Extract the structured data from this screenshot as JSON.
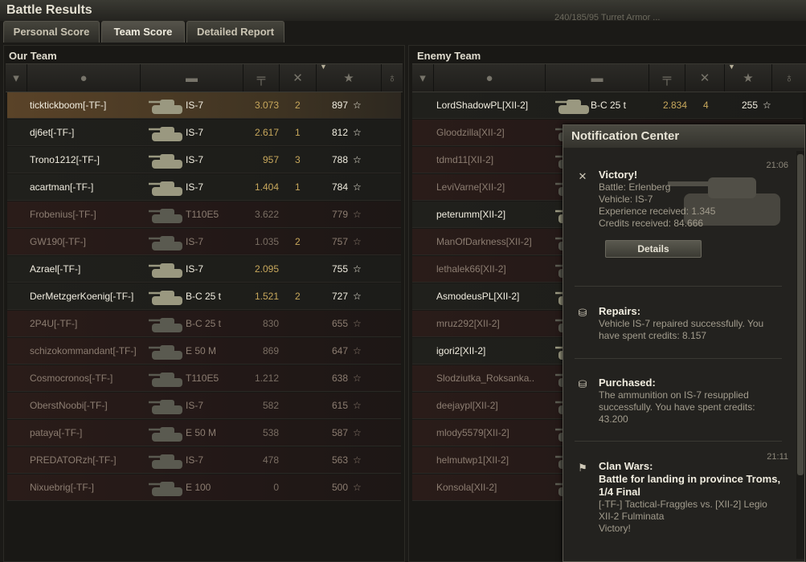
{
  "window": {
    "title": "Battle Results",
    "background_text": "240/185/95  Turret Armor  ..."
  },
  "tabs": [
    {
      "label": "Personal Score",
      "active": false
    },
    {
      "label": "Team Score",
      "active": true
    },
    {
      "label": "Detailed Report",
      "active": false
    }
  ],
  "our_team": {
    "title": "Our Team",
    "rows": [
      {
        "player": "ticktickboom[-TF-]",
        "vehicle": "IS-7",
        "damage": "3.073",
        "kills": "2",
        "xp": "897",
        "state": "self"
      },
      {
        "player": "dj6et[-TF-]",
        "vehicle": "IS-7",
        "damage": "2.617",
        "kills": "1",
        "xp": "812",
        "state": "bright"
      },
      {
        "player": "Trono1212[-TF-]",
        "vehicle": "IS-7",
        "damage": "957",
        "kills": "3",
        "xp": "788",
        "state": "bright"
      },
      {
        "player": "acartman[-TF-]",
        "vehicle": "IS-7",
        "damage": "1.404",
        "kills": "1",
        "xp": "784",
        "state": "bright"
      },
      {
        "player": "Frobenius[-TF-]",
        "vehicle": "T110E5",
        "damage": "3.622",
        "kills": "",
        "xp": "779",
        "state": "dead"
      },
      {
        "player": "GW190[-TF-]",
        "vehicle": "IS-7",
        "damage": "1.035",
        "kills": "2",
        "xp": "757",
        "state": "dead"
      },
      {
        "player": "Azrael[-TF-]",
        "vehicle": "IS-7",
        "damage": "2.095",
        "kills": "",
        "xp": "755",
        "state": "bright"
      },
      {
        "player": "DerMetzgerKoenig[-TF-]",
        "vehicle": "B-C 25 t",
        "damage": "1.521",
        "kills": "2",
        "xp": "727",
        "state": "bright"
      },
      {
        "player": "2P4U[-TF-]",
        "vehicle": "B-C 25 t",
        "damage": "830",
        "kills": "",
        "xp": "655",
        "state": "dead"
      },
      {
        "player": "schizokommandant[-TF-]",
        "vehicle": "E 50 M",
        "damage": "869",
        "kills": "",
        "xp": "647",
        "state": "dead"
      },
      {
        "player": "Cosmocronos[-TF-]",
        "vehicle": "T110E5",
        "damage": "1.212",
        "kills": "",
        "xp": "638",
        "state": "dead"
      },
      {
        "player": "OberstNoobi[-TF-]",
        "vehicle": "IS-7",
        "damage": "582",
        "kills": "",
        "xp": "615",
        "state": "dead"
      },
      {
        "player": "pataya[-TF-]",
        "vehicle": "E 50 M",
        "damage": "538",
        "kills": "",
        "xp": "587",
        "state": "dead"
      },
      {
        "player": "PREDATORzh[-TF-]",
        "vehicle": "IS-7",
        "damage": "478",
        "kills": "",
        "xp": "563",
        "state": "dead"
      },
      {
        "player": "Nixuebrig[-TF-]",
        "vehicle": "E 100",
        "damage": "0",
        "kills": "",
        "xp": "500",
        "state": "dead"
      }
    ]
  },
  "enemy_team": {
    "title": "Enemy Team",
    "rows": [
      {
        "player": "LordShadowPL[XII-2]",
        "vehicle": "B-C 25 t",
        "damage": "2.834",
        "kills": "4",
        "xp": "255",
        "state": "bright"
      },
      {
        "player": "Gloodzilla[XII-2]",
        "state": "dead"
      },
      {
        "player": "tdmd11[XII-2]",
        "state": "dead"
      },
      {
        "player": "LeviVarne[XII-2]",
        "state": "dead"
      },
      {
        "player": "peterumm[XII-2]",
        "state": "bright"
      },
      {
        "player": "ManOfDarkness[XII-2]",
        "state": "dead"
      },
      {
        "player": "lethalek66[XII-2]",
        "state": "dead"
      },
      {
        "player": "AsmodeusPL[XII-2]",
        "state": "bright"
      },
      {
        "player": "mruz292[XII-2]",
        "state": "dead"
      },
      {
        "player": "igori2[XII-2]",
        "state": "bright"
      },
      {
        "player": "Slodziutka_Roksanka..",
        "state": "dead"
      },
      {
        "player": "deejaypl[XII-2]",
        "state": "dead"
      },
      {
        "player": "mlody5579[XII-2]",
        "state": "dead"
      },
      {
        "player": "helmutwp1[XII-2]",
        "state": "dead"
      },
      {
        "player": "Konsola[XII-2]",
        "state": "dead"
      }
    ]
  },
  "notifications": {
    "title": "Notification Center",
    "items": [
      {
        "icon": "crossed-swords-icon",
        "time": "21:06",
        "head": "Victory!",
        "lines": [
          "Battle: Erlenberg",
          "Vehicle: IS-7",
          "Experience received: 1.345",
          "Credits received: 84.666"
        ],
        "button": "Details"
      },
      {
        "icon": "coins-icon",
        "time": "",
        "head": "Repairs:",
        "lines": [
          "Vehicle IS-7 repaired successfully. You",
          "have spent credits:  8.157"
        ]
      },
      {
        "icon": "coins-icon",
        "time": "",
        "head": "Purchased:",
        "lines": [
          "The ammunition on IS-7 resupplied",
          "successfully. You have spent credits:",
          "43.200"
        ]
      },
      {
        "icon": "clan-flag-icon",
        "time": "21:11",
        "head": "Clan Wars:",
        "subhead": [
          "Battle for landing in province Troms,",
          "1/4 Final"
        ],
        "lines": [
          "[-TF-] Tactical-Fraggles vs. [XII-2] Legio",
          "XII-2 Fulminata",
          "Victory!"
        ]
      }
    ]
  },
  "colors": {
    "accent": "#c8a85c",
    "self_row": "#5a4328",
    "dead_row": "#2a1c19"
  }
}
